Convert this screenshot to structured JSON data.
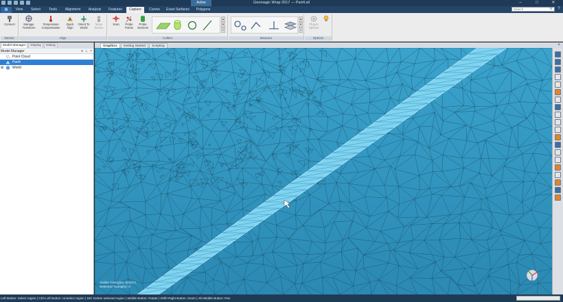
{
  "titlebar": {
    "title": "Geomagic Wrap 2017 — Part4.stl",
    "context_badge": "Active",
    "minimize": "–",
    "maximize": "□",
    "close": "✕"
  },
  "ribbon_tabs": [
    "View",
    "Select",
    "Tools",
    "Alignment",
    "Analysis",
    "Features",
    "Capture",
    "Curves",
    "Exact Surfaces",
    "Polygons"
  ],
  "selected_ribbon_tab": "Capture",
  "search": {
    "placeholder": "Search"
  },
  "ribbon": {
    "device": {
      "caption": "Device",
      "connect": "Connect"
    },
    "align": {
      "caption": "Align",
      "manage_transform": "Manage Transform",
      "temperature_compensation": "Temperature Compensation",
      "quick_align": "Quick Align",
      "orient_to_world": "Orient To World",
      "move_device": "Move Device"
    },
    "collect": {
      "caption": "Collect",
      "scan": "Scan",
      "probe_points": "Probe Points",
      "probe_sections": "Probe Sections"
    },
    "measure": {
      "caption": "Measure"
    },
    "options": {
      "caption": "Options",
      "plugin_options": "Plug-in Options"
    }
  },
  "left_panel": {
    "tabs": [
      "Model Manager",
      "Display",
      "Dialog"
    ],
    "header": "Model Manager",
    "tree": [
      {
        "label": "Point Cloud"
      },
      {
        "label": "Part4"
      },
      {
        "label": "World"
      }
    ]
  },
  "viewport_tabs": [
    "Graphics",
    "Getting Started",
    "Scripting"
  ],
  "viewport": {
    "stats_line1": "Visible Triangles: 820371",
    "stats_line2": "Selected Triangles: 0"
  },
  "statusbar": {
    "text": "Left Button: Select region | Ctrl+Left Button: Unselect region | Del: Delete selected region | Middle Button: Rotate | Shift+Right Button: Zoom | Alt+Middle Button: Pan"
  },
  "colors": {
    "titlebar": "#1f3a56",
    "viewport_bg": "#2f93bd",
    "stripe": "#7fd4f2",
    "selection": "#2f7fd3"
  }
}
